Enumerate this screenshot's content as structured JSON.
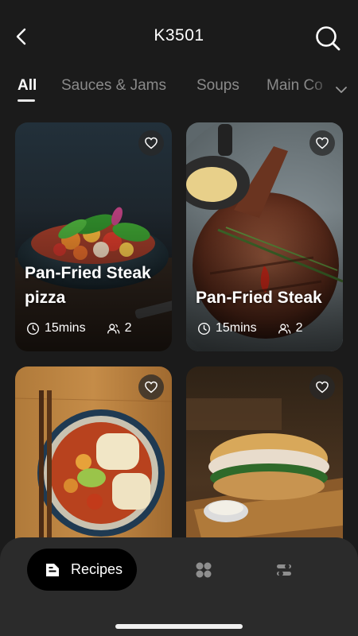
{
  "header": {
    "title": "K3501",
    "back_icon": "chevron-left-icon",
    "search_icon": "search-icon"
  },
  "tabs": [
    {
      "label": "All",
      "active": true
    },
    {
      "label": "Sauces & Jams",
      "active": false
    },
    {
      "label": "Soups",
      "active": false
    },
    {
      "label": "Main Co",
      "active": false
    }
  ],
  "tabs_more_icon": "chevron-down-icon",
  "recipes": [
    {
      "title": "Pan-Fried Steak pizza",
      "time": "15mins",
      "servings": "2",
      "image": "salad-bowl-photo"
    },
    {
      "title": "Pan-Fried Steak",
      "time": "15mins",
      "servings": "2",
      "image": "grilled-steak-photo"
    },
    {
      "title": "",
      "time": "",
      "servings": "",
      "image": "noodle-soup-photo"
    },
    {
      "title": "",
      "time": "",
      "servings": "",
      "image": "sandwich-photo"
    }
  ],
  "bottom_nav": {
    "recipes_label": "Recipes",
    "recipes_icon": "recipe-book-icon",
    "collections_icon": "grid-icon",
    "settings_icon": "sliders-icon"
  },
  "colors": {
    "background": "#1b1b1b",
    "bottom_bar": "#2b2b2b",
    "active_tab": "#ffffff",
    "inactive_tab": "#8a8a8a"
  }
}
